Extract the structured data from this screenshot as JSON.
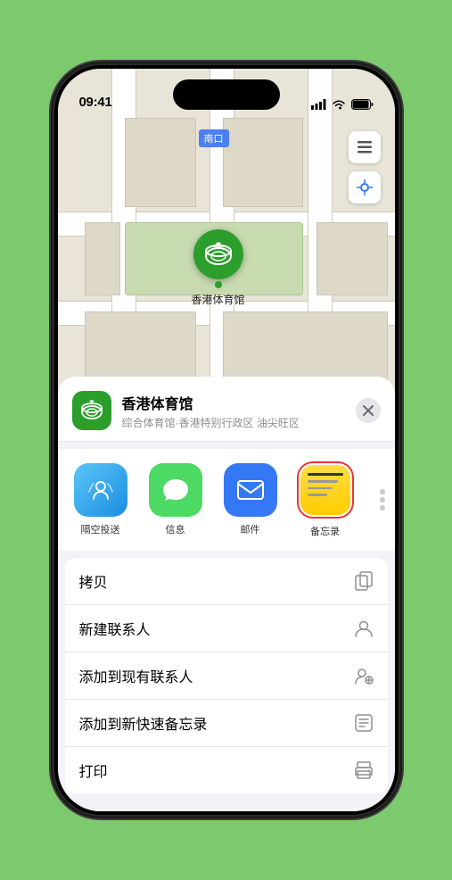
{
  "status_bar": {
    "time": "09:41",
    "signal_icon": "signal",
    "wifi_icon": "wifi",
    "battery_icon": "battery"
  },
  "map": {
    "label": "南口",
    "pin_label": "香港体育馆"
  },
  "location_header": {
    "name": "香港体育馆",
    "detail": "综合体育馆·香港特别行政区 油尖旺区",
    "close_label": "×"
  },
  "share_actions": [
    {
      "id": "airdrop",
      "label": "隔空投送",
      "type": "airdrop"
    },
    {
      "id": "messages",
      "label": "信息",
      "type": "messages"
    },
    {
      "id": "mail",
      "label": "邮件",
      "type": "mail"
    },
    {
      "id": "notes",
      "label": "备忘录",
      "type": "notes",
      "selected": true
    }
  ],
  "action_items": [
    {
      "id": "copy",
      "label": "拷贝",
      "icon": "📋"
    },
    {
      "id": "new-contact",
      "label": "新建联系人",
      "icon": "👤"
    },
    {
      "id": "add-contact",
      "label": "添加到现有联系人",
      "icon": "👤➕"
    },
    {
      "id": "quick-note",
      "label": "添加到新快速备忘录",
      "icon": "📝"
    },
    {
      "id": "print",
      "label": "打印",
      "icon": "🖨"
    }
  ]
}
